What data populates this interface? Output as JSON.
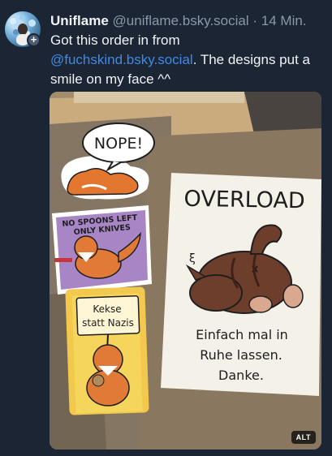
{
  "post": {
    "author": {
      "display_name": "Uniflame",
      "handle": "@uniflame.bsky.social",
      "separator": "·",
      "timestamp": "14 Min.",
      "avatar_icon": "avatar-icon",
      "follow_badge": "+"
    },
    "text": {
      "line1": "Got this order in from",
      "mention": "@fuchskind.bsky.social",
      "rest": ". The designs put a smile on my face ^^"
    },
    "image": {
      "alt_badge": "ALT",
      "stickers": {
        "nope": "NOPE!",
        "spoons_line1": "NO SPOONS LEFT",
        "spoons_line2": "ONLY KNIVES",
        "kekse_line1": "Kekse",
        "kekse_line2": "statt Nazis"
      },
      "card": {
        "title": "OVERLOAD",
        "caption_line1": "Einfach mal in",
        "caption_line2": "Ruhe lassen.",
        "caption_line3": "Danke."
      }
    }
  },
  "colors": {
    "background": "#1b2533",
    "text": "#f1f3f5",
    "muted": "#8b98a9",
    "link": "#3f8ae8"
  }
}
